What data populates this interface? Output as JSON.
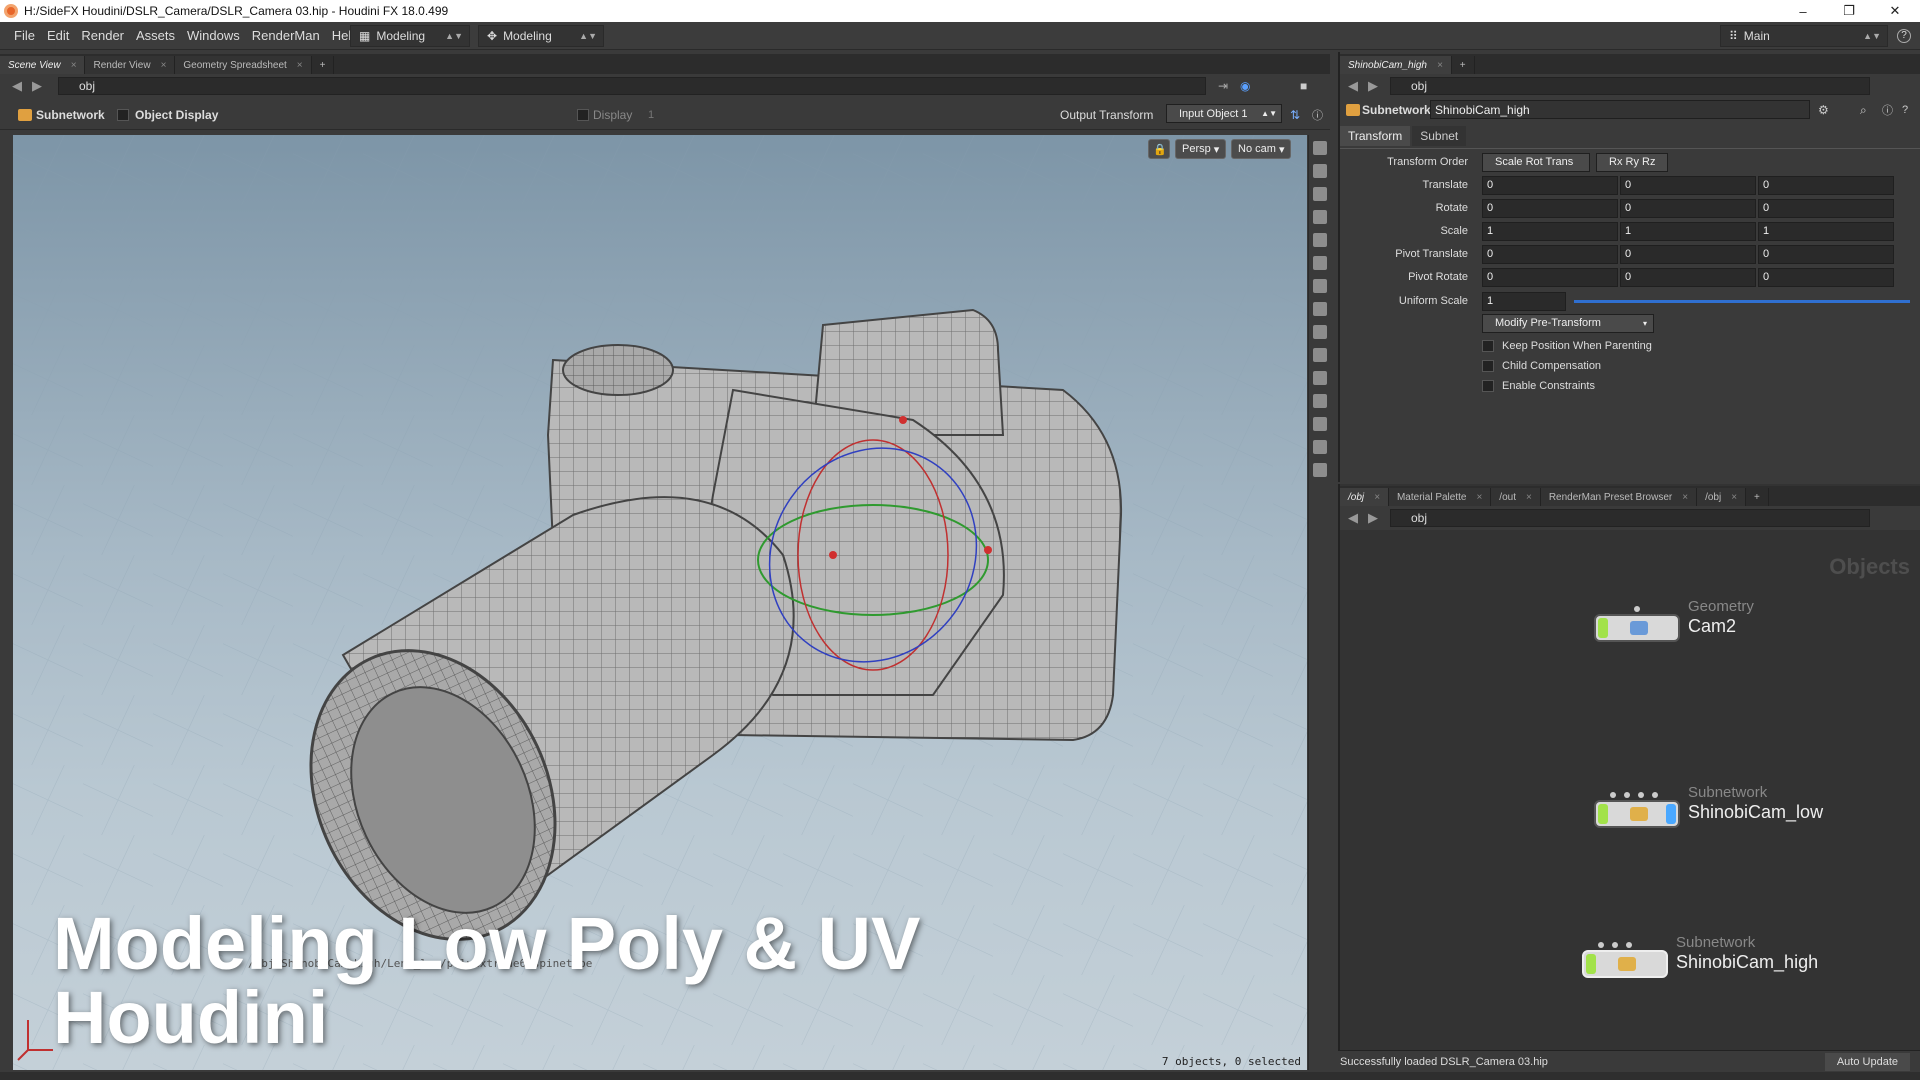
{
  "title": "H:/SideFX Houdini/DSLR_Camera/DSLR_Camera 03.hip - Houdini FX 18.0.499",
  "menu": [
    "File",
    "Edit",
    "Render",
    "Assets",
    "Windows",
    "RenderMan",
    "Help"
  ],
  "desktops": {
    "first": "Modeling",
    "second": "Modeling",
    "main": "Main"
  },
  "left_tabs": [
    "Scene View",
    "Render View",
    "Geometry Spreadsheet"
  ],
  "left_path": "obj",
  "viewport_header": {
    "network": "Subnetwork",
    "object_display": "Object Display",
    "display": "Display",
    "display_value": "1",
    "output_transform": "Output Transform",
    "input": "Input Object 1"
  },
  "viewport": {
    "persp": "Persp",
    "cam": "No cam",
    "status": "7 objects, 0 selected",
    "faint_path": "/obj/ShinobiCam_high/Lens_low/polyextrude6/spinetype"
  },
  "overlay": {
    "line1": "Modeling Low Poly & UV",
    "line2": "Houdini"
  },
  "param_tabs_strip": [
    "ShinobiCam_high"
  ],
  "param_path": "obj",
  "param_header": {
    "type": "Subnetwork",
    "name": "ShinobiCam_high"
  },
  "param_tabs": [
    "Transform",
    "Subnet"
  ],
  "params": {
    "transform_order_label": "Transform Order",
    "transform_order": "Scale Rot Trans",
    "rot_order": "Rx Ry Rz",
    "rows": [
      {
        "label": "Translate",
        "v": [
          "0",
          "0",
          "0"
        ]
      },
      {
        "label": "Rotate",
        "v": [
          "0",
          "0",
          "0"
        ]
      },
      {
        "label": "Scale",
        "v": [
          "1",
          "1",
          "1"
        ]
      },
      {
        "label": "Pivot Translate",
        "v": [
          "0",
          "0",
          "0"
        ]
      },
      {
        "label": "Pivot Rotate",
        "v": [
          "0",
          "0",
          "0"
        ]
      }
    ],
    "uniform_label": "Uniform Scale",
    "uniform": "1",
    "modify": "Modify Pre-Transform",
    "checks": [
      "Keep Position When Parenting",
      "Child Compensation",
      "Enable Constraints"
    ]
  },
  "net_tabs": [
    "/obj",
    "Material Palette",
    "/out",
    "RenderMan Preset Browser",
    "/obj"
  ],
  "net_path": "obj",
  "net_label": "Objects",
  "nodes": [
    {
      "type": "Geometry",
      "name": "Cam2"
    },
    {
      "type": "Subnetwork",
      "name": "ShinobiCam_low"
    },
    {
      "type": "Subnetwork",
      "name": "ShinobiCam_high"
    }
  ],
  "status": {
    "message": "Successfully loaded DSLR_Camera 03.hip",
    "auto": "Auto Update"
  },
  "colors": {
    "node_green": "#a2e24a",
    "node_blue": "#4aa8ff",
    "slider": "#2f6fd0"
  }
}
